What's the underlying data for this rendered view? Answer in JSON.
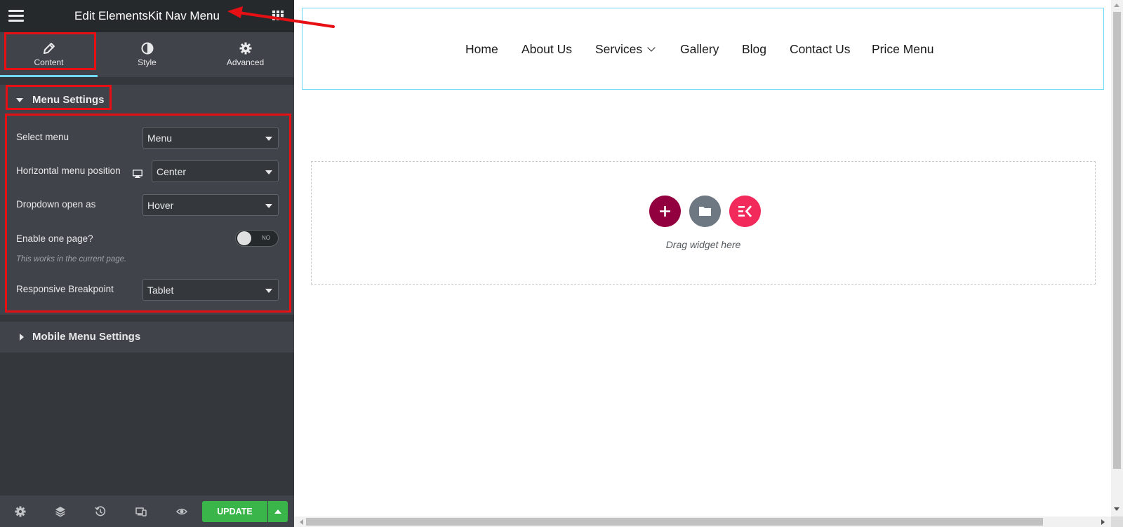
{
  "panel": {
    "title": "Edit ElementsKit Nav Menu",
    "menu_icon": "hamburger-icon",
    "apps_icon": "grid-icon",
    "tabs": [
      {
        "label": "Content",
        "icon": "pencil-icon",
        "active": true
      },
      {
        "label": "Style",
        "icon": "half-circle-icon",
        "active": false
      },
      {
        "label": "Advanced",
        "icon": "gear-icon",
        "active": false
      }
    ],
    "menu_settings": {
      "title": "Menu Settings",
      "expanded": true,
      "select_menu": {
        "label": "Select menu",
        "value": "Menu"
      },
      "horizontal_position": {
        "label": "Horizontal menu position",
        "value": "Center",
        "device_icon": "desktop-icon"
      },
      "dropdown_open": {
        "label": "Dropdown open as",
        "value": "Hover"
      },
      "one_page": {
        "label": "Enable one page?",
        "toggle_text": "NO",
        "enabled": false,
        "helper": "This works in the current page."
      },
      "breakpoint": {
        "label": "Responsive Breakpoint",
        "value": "Tablet"
      }
    },
    "mobile_settings": {
      "title": "Mobile Menu Settings",
      "expanded": false
    },
    "footer": {
      "icons": [
        "settings-icon",
        "layers-icon",
        "history-icon",
        "responsive-icon",
        "eye-icon"
      ],
      "update_label": "UPDATE"
    }
  },
  "preview": {
    "nav_items": [
      "Home",
      "About Us",
      "Services",
      "Gallery",
      "Blog",
      "Contact Us",
      "Price Menu"
    ],
    "drop_zone_text": "Drag widget here"
  },
  "colors": {
    "panel_bg": "#34383c",
    "accent": "#71d7f7",
    "update_green": "#39b54a",
    "annotation_red": "#e60f14",
    "add_button": "#93003f",
    "elementskit_button": "#f2295b"
  }
}
